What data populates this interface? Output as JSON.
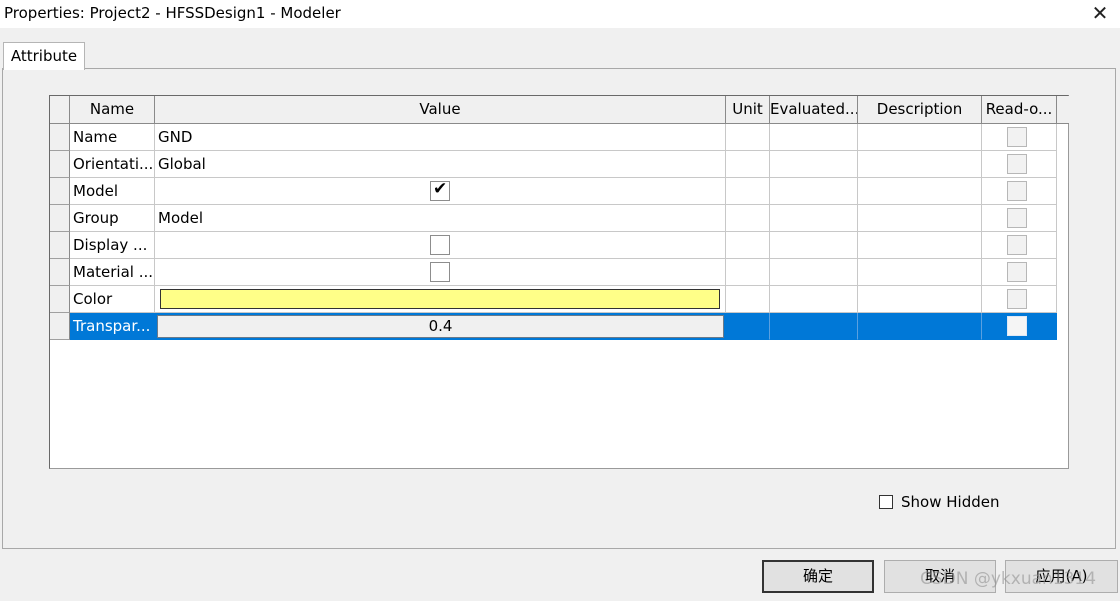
{
  "window": {
    "title": "Properties: Project2 - HFSSDesign1 - Modeler",
    "close_icon": "close-icon"
  },
  "tabs": [
    {
      "label": "Attribute",
      "active": true
    }
  ],
  "grid": {
    "columns": [
      "Name",
      "Value",
      "Unit",
      "Evaluated...",
      "Description",
      "Read-o..."
    ],
    "rows": [
      {
        "name": "Name",
        "value": "GND",
        "kind": "text"
      },
      {
        "name": "Orientati...",
        "value": "Global",
        "kind": "text"
      },
      {
        "name": "Model",
        "value": "",
        "kind": "checkbox",
        "checked": true
      },
      {
        "name": "Group",
        "value": "Model",
        "kind": "text"
      },
      {
        "name": "Display ...",
        "value": "",
        "kind": "checkbox",
        "checked": false
      },
      {
        "name": "Material ...",
        "value": "",
        "kind": "checkbox",
        "checked": false
      },
      {
        "name": "Color",
        "value": "",
        "kind": "color",
        "color": "#ffff88"
      },
      {
        "name": "Transpar...",
        "value": "0.4",
        "kind": "edit",
        "selected": true
      }
    ]
  },
  "show_hidden": {
    "label": "Show Hidden",
    "checked": false
  },
  "buttons": {
    "ok": "确定",
    "cancel": "取消",
    "apply": "应用(A)"
  },
  "watermark": "CSDN @ykxuan1314",
  "colors": {
    "selection": "#0078d7",
    "swatch": "#ffff88"
  }
}
